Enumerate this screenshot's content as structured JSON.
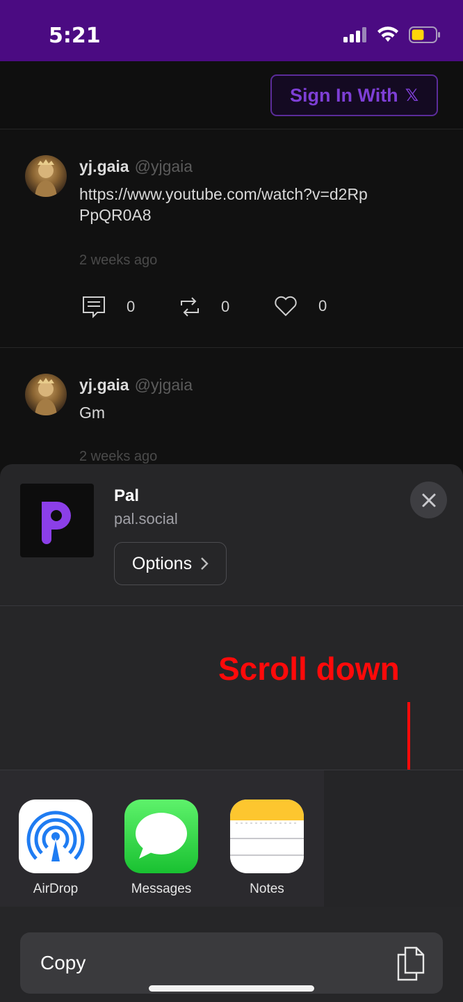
{
  "status_bar": {
    "time": "5:21",
    "background": "#4b0b82"
  },
  "header": {
    "sign_in_label": "Sign In With",
    "sign_in_brand": "𝕏"
  },
  "posts": [
    {
      "name": "yj.gaia",
      "handle": "@yjgaia",
      "text": "https://www.youtube.com/watch?v=d2RpPpQR0A8",
      "time": "2 weeks ago",
      "comments": "0",
      "reposts": "0",
      "likes": "0"
    },
    {
      "name": "yj.gaia",
      "handle": "@yjgaia",
      "text": "Gm",
      "time": "2 weeks ago"
    }
  ],
  "share_sheet": {
    "app_title": "Pal",
    "app_subtitle": "pal.social",
    "options_label": "Options",
    "apps": [
      {
        "label": "AirDrop",
        "icon": "airdrop-icon"
      },
      {
        "label": "Messages",
        "icon": "messages-icon"
      },
      {
        "label": "Notes",
        "icon": "notes-icon"
      }
    ],
    "copy_label": "Copy"
  },
  "annotation": {
    "text": "Scroll down",
    "color": "#ff0a0a"
  }
}
